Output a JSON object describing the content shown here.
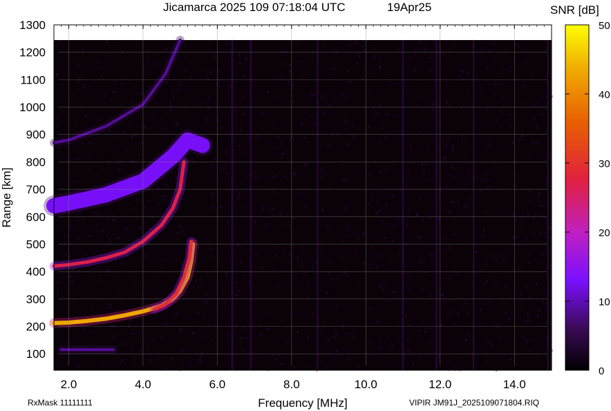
{
  "chart_data": {
    "type": "heatmap",
    "title": "Jicamarca 2025 109 07:18:04 UTC",
    "date_label": "19Apr25",
    "xlabel": "Frequency [MHz]",
    "ylabel": "Range [km]",
    "xlim": [
      1.6,
      15.0
    ],
    "ylim": [
      40,
      1300
    ],
    "data_ylim": [
      40,
      1245
    ],
    "x_ticks": [
      2.0,
      4.0,
      6.0,
      8.0,
      10.0,
      12.0,
      14.0
    ],
    "x_tick_labels": [
      "2.0",
      "4.0",
      "6.0",
      "8.0",
      "10.0",
      "12.0",
      "14.0"
    ],
    "y_ticks": [
      100,
      200,
      300,
      400,
      500,
      600,
      700,
      800,
      900,
      1000,
      1100,
      1200,
      1300
    ],
    "y_tick_labels": [
      "100",
      "200",
      "300",
      "400",
      "500",
      "600",
      "700",
      "800",
      "900",
      "1000",
      "1100",
      "1200",
      "1300"
    ],
    "colorbar": {
      "label": "SNR [dB]",
      "range": [
        0,
        50
      ],
      "ticks": [
        0,
        10,
        20,
        30,
        40,
        50
      ],
      "tick_labels": [
        "0",
        "10",
        "20",
        "30",
        "40",
        "50"
      ],
      "colormap": [
        "#000000",
        "#3a0a55",
        "#7a10ff",
        "#c020c0",
        "#e02040",
        "#e86000",
        "#f0b000",
        "#ffff00"
      ]
    },
    "grid": true,
    "echo_traces": [
      {
        "name": "F-layer 1st-hop trace (O-mode)",
        "peak_snr_db": 42,
        "points": [
          [
            1.6,
            212
          ],
          [
            2.0,
            214
          ],
          [
            2.5,
            220
          ],
          [
            3.0,
            228
          ],
          [
            3.5,
            240
          ],
          [
            4.0,
            255
          ],
          [
            4.5,
            275
          ],
          [
            4.8,
            300
          ],
          [
            5.0,
            330
          ],
          [
            5.2,
            380
          ],
          [
            5.3,
            440
          ],
          [
            5.35,
            500
          ]
        ]
      },
      {
        "name": "F-layer 1st-hop trace (X-mode)",
        "peak_snr_db": 30,
        "points": [
          [
            4.3,
            262
          ],
          [
            4.6,
            280
          ],
          [
            4.9,
            320
          ],
          [
            5.1,
            380
          ],
          [
            5.25,
            450
          ],
          [
            5.3,
            510
          ]
        ]
      },
      {
        "name": "F-layer 2nd-hop trace",
        "peak_snr_db": 28,
        "points": [
          [
            1.6,
            420
          ],
          [
            2.0,
            425
          ],
          [
            2.5,
            435
          ],
          [
            3.0,
            450
          ],
          [
            3.5,
            470
          ],
          [
            4.0,
            510
          ],
          [
            4.5,
            570
          ],
          [
            4.8,
            630
          ],
          [
            5.0,
            700
          ],
          [
            5.1,
            800
          ]
        ]
      },
      {
        "name": "diffuse spread echo",
        "peak_snr_db": 14,
        "points": [
          [
            1.6,
            640
          ],
          [
            2.0,
            650
          ],
          [
            3.0,
            680
          ],
          [
            4.0,
            730
          ],
          [
            4.8,
            820
          ],
          [
            5.2,
            880
          ],
          [
            5.6,
            860
          ]
        ]
      },
      {
        "name": "3rd-hop trace",
        "peak_snr_db": 10,
        "points": [
          [
            1.6,
            870
          ],
          [
            2.0,
            880
          ],
          [
            3.0,
            930
          ],
          [
            4.0,
            1010
          ],
          [
            4.6,
            1120
          ],
          [
            5.0,
            1245
          ]
        ]
      },
      {
        "name": "low-range interference",
        "peak_snr_db": 10,
        "points": [
          [
            1.8,
            115
          ],
          [
            2.5,
            115
          ],
          [
            3.2,
            115
          ]
        ]
      }
    ],
    "vertical_interference_lines_mhz": [
      6.4,
      6.9,
      8.7,
      11.0,
      11.9,
      12.9,
      14.9
    ],
    "footer_left": "RxMask 11111111",
    "footer_right": "VIPIR  JM91J_2025109071804.RIQ"
  }
}
